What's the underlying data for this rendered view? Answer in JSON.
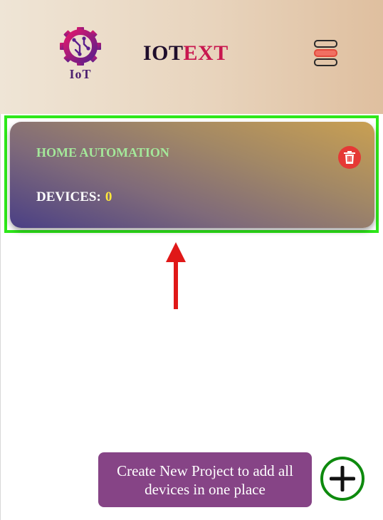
{
  "header": {
    "logo_text": "IoT",
    "brand_part1": "IOT",
    "brand_part2": "EXT"
  },
  "project_card": {
    "title": "HOME AUTOMATION",
    "devices_label": "DEVICES:",
    "devices_count": "0"
  },
  "tooltip": {
    "text": "Create New Project to add all devices in one place"
  },
  "colors": {
    "brand_accent": "#c8174f",
    "highlight": "#2ee81a",
    "delete": "#e53935",
    "add_ring": "#0e8a0e",
    "tooltip_bg": "#864486",
    "arrow": "#e01818"
  },
  "icons": {
    "logo": "gear-circuit-icon",
    "menu": "hamburger-menu-icon",
    "delete": "trash-icon",
    "add": "plus-icon",
    "pointer": "up-arrow-icon"
  }
}
